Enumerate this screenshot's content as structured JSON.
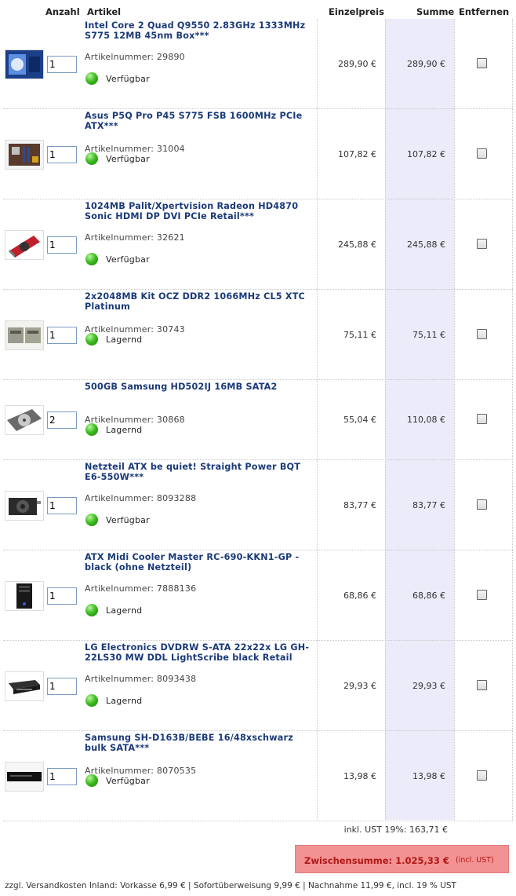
{
  "header": {
    "qty": "Anzahl",
    "article": "Artikel",
    "unit_price": "Einzelpreis",
    "sum": "Summe",
    "remove": "Entfernen"
  },
  "items": [
    {
      "title": "Intel Core 2 Quad Q9550 2.83GHz 1333MHz S775 12MB 45nm Box***",
      "artnr": "Artikelnummer: 29890",
      "qty": "1",
      "status": "Verfügbar",
      "price": "289,90 €",
      "sum": "289,90 €",
      "thumb": "cpu-box"
    },
    {
      "title": "Asus P5Q Pro P45 S775 FSB 1600MHz PCIe ATX***",
      "artnr": "Artikelnummer: 31004",
      "qty": "1",
      "status": "Verfügbar",
      "price": "107,82 €",
      "sum": "107,82 €",
      "thumb": "motherboard"
    },
    {
      "title": "1024MB Palit/Xpertvision Radeon HD4870 Sonic HDMI DP DVI PCIe Retail***",
      "artnr": "Artikelnummer: 32621",
      "qty": "1",
      "status": "Verfügbar",
      "price": "245,88 €",
      "sum": "245,88 €",
      "thumb": "graphics-card"
    },
    {
      "title": "2x2048MB Kit OCZ DDR2 1066MHz CL5 XTC Platinum",
      "artnr": "Artikelnummer: 30743",
      "qty": "1",
      "status": "Lagernd",
      "price": "75,11 €",
      "sum": "75,11 €",
      "thumb": "ram"
    },
    {
      "title": "500GB Samsung HD502IJ 16MB SATA2",
      "artnr": "Artikelnummer: 30868",
      "qty": "2",
      "status": "Lagernd",
      "price": "55,04 €",
      "sum": "110,08 €",
      "thumb": "hard-drive"
    },
    {
      "title": "Netzteil ATX be quiet! Straight Power BQT E6-550W***",
      "artnr": "Artikelnummer: 8093288",
      "qty": "1",
      "status": "Verfügbar",
      "price": "83,77 €",
      "sum": "83,77 €",
      "thumb": "power-supply"
    },
    {
      "title": "ATX Midi Cooler Master RC-690-KKN1-GP - black (ohne Netzteil)",
      "artnr": "Artikelnummer: 7888136",
      "qty": "1",
      "status": "Lagernd",
      "price": "68,86 €",
      "sum": "68,86 €",
      "thumb": "pc-case"
    },
    {
      "title": "LG Electronics DVDRW S-ATA 22x22x LG GH-22LS30 MW DDL LightScribe black Retail",
      "artnr": "Artikelnummer: 8093438",
      "qty": "1",
      "status": "Lagernd",
      "price": "29,93 €",
      "sum": "29,93 €",
      "thumb": "dvd-drive"
    },
    {
      "title": "Samsung SH-D163B/BEBE 16/48xschwarz bulk SATA***",
      "artnr": "Artikelnummer: 8070535",
      "qty": "1",
      "status": "Verfügbar",
      "price": "13,98 €",
      "sum": "13,98 €",
      "thumb": "dvd-rom"
    }
  ],
  "vat_line": "inkl. UST 19%: 163,71 €",
  "subtotal": {
    "label": "Zwischensumme: 1.025,33 €",
    "incl": "(incl. UST)"
  },
  "shipping": "zzgl. Versandkosten Inland: Vorkasse 6,99 € | Sofortüberweisung 9,99 € | Nachnahme 11,99 €, incl. 19 % UST",
  "colors": {
    "title": "#1a3a78",
    "sum_bg": "#ebebf9",
    "subtotal_bg": "#f39292",
    "subtotal_text": "#b01818",
    "stock_green": "#3fbf22"
  }
}
